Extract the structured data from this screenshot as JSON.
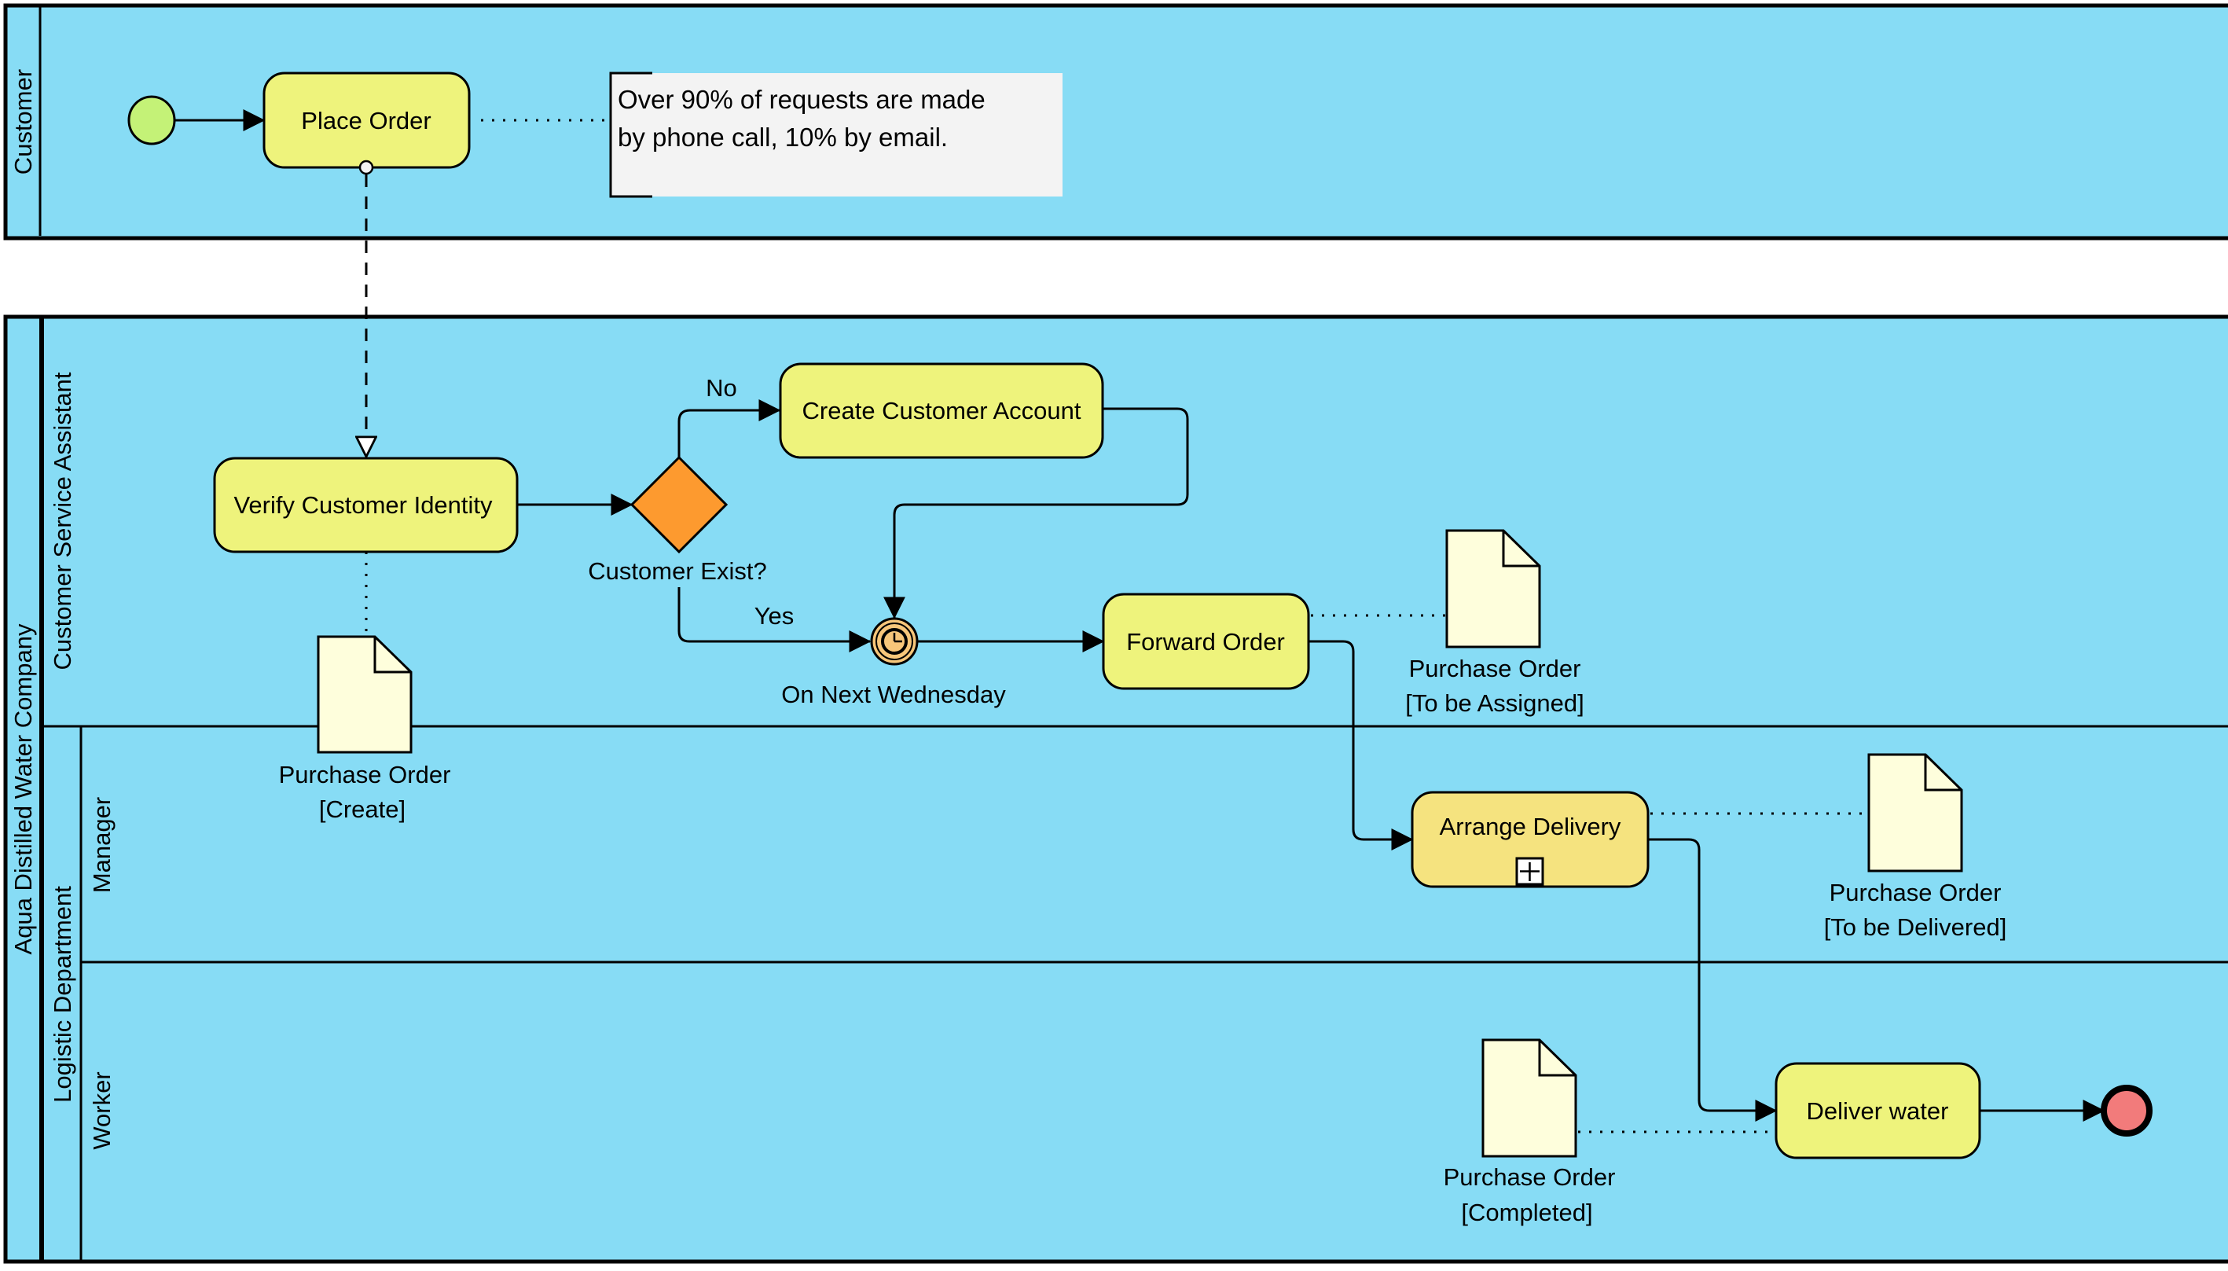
{
  "colors": {
    "lane_fill": "#87dcf5",
    "task_fill": "#eef37c",
    "subprocess_fill": "#f5e37f",
    "gateway_fill": "#fd9a2f",
    "start_fill": "#c4f277",
    "end_fill": "#f27b7b",
    "timer_fill": "#f7c67a",
    "data_fill": "#fefedc",
    "note_fill": "#f3f3f3",
    "stroke": "#000000"
  },
  "pools": [
    {
      "id": "customer",
      "label": "Customer"
    },
    {
      "id": "company",
      "label": "Aqua Distilled Water Company",
      "lanes": [
        {
          "id": "csa",
          "label": "Customer Service Assistant"
        },
        {
          "id": "logistic",
          "label": "Logistic Department",
          "sublanes": [
            {
              "id": "manager",
              "label": "Manager"
            },
            {
              "id": "worker",
              "label": "Worker"
            }
          ]
        }
      ]
    }
  ],
  "tasks": [
    {
      "id": "place-order",
      "label": "Place Order",
      "type": "task"
    },
    {
      "id": "verify-customer-identity",
      "label": "Verify Customer Identity",
      "type": "task"
    },
    {
      "id": "create-customer-account",
      "label": "Create Customer Account",
      "type": "task"
    },
    {
      "id": "forward-order",
      "label": "Forward Order",
      "type": "task"
    },
    {
      "id": "arrange-delivery",
      "label": "Arrange Delivery",
      "type": "collapsed-subprocess"
    },
    {
      "id": "deliver-water",
      "label": "Deliver water",
      "type": "task"
    }
  ],
  "gateway": {
    "id": "customer-exist",
    "label": "Customer Exist?",
    "type": "exclusive"
  },
  "events": {
    "start": {
      "type": "start"
    },
    "timer": {
      "label": "On Next Wednesday",
      "type": "intermediate-timer",
      "icon": "clock-icon"
    },
    "end": {
      "type": "end"
    }
  },
  "flow_labels": {
    "no": "No",
    "yes": "Yes"
  },
  "annotation": {
    "lines": [
      "Over 90% of requests are made",
      "by phone call, 10% by email."
    ]
  },
  "data_objects": [
    {
      "id": "po-create",
      "name": "Purchase Order",
      "state": "[Create]"
    },
    {
      "id": "po-assigned",
      "name": "Purchase Order",
      "state": "[To be Assigned]"
    },
    {
      "id": "po-delivered",
      "name": "Purchase Order",
      "state": "[To be Delivered]"
    },
    {
      "id": "po-completed",
      "name": "Purchase Order",
      "state": "[Completed]"
    }
  ]
}
